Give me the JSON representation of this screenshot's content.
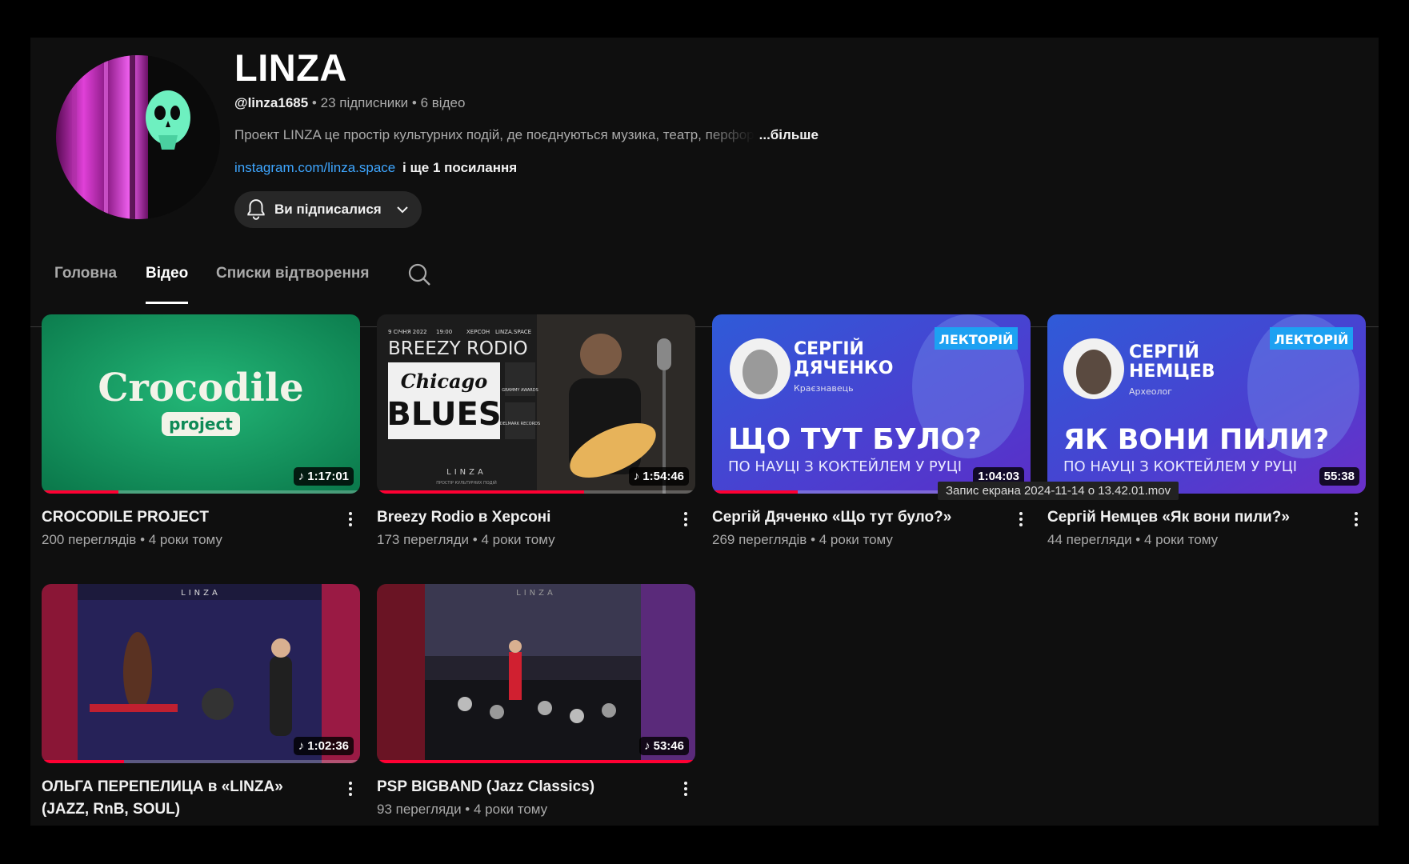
{
  "channel": {
    "name": "LINZA",
    "handle": "@linza1685",
    "subscribers": "23 підписники",
    "videos_count": "6 відео",
    "description": "Проект LINZA це простір культурних подій, де поєднуються музика, театр, перфор",
    "more_label": "...більше",
    "link_text": "instagram.com/linza.space",
    "more_links": "і ще 1 посилання",
    "subscribe_label": "Ви підписалися"
  },
  "tabs": [
    {
      "label": "Головна",
      "active": false
    },
    {
      "label": "Відео",
      "active": true
    },
    {
      "label": "Списки відтворення",
      "active": false
    }
  ],
  "videos": [
    {
      "title": "CROCODILE PROJECT",
      "views": "200 переглядів",
      "age": "4 роки тому",
      "duration": "1:17:01",
      "progress": 0.24,
      "thumb_text": [
        "Crocodile",
        "project"
      ]
    },
    {
      "title": "Breezy Rodio в Херсоні",
      "views": "173 перегляди",
      "age": "4 роки тому",
      "duration": "1:54:46",
      "progress": 0.65,
      "thumb_text": [
        "9 СІЧНЯ 2022",
        "19:00",
        "ХЕРСОН",
        "LINZA.SPACE",
        "BREEZY RODIO",
        "Chicago",
        "BLUES",
        "GRAMMY AWARDS",
        "DELMARK RECORDS",
        "LINZA",
        "ПРОСТІР КУЛЬТУРНИХ ПОДІЙ"
      ]
    },
    {
      "title": "Сергій Дяченко «Що тут було?»",
      "views": "269 переглядів",
      "age": "4 роки тому",
      "duration": "1:04:03",
      "progress": 0.27,
      "thumb_text": [
        "ЛЕКТОРІЙ",
        "СЕРГІЙ",
        "ДЯЧЕНКО",
        "Краєзнавець",
        "ЩО ТУТ БУЛО?",
        "ПО НАУЦІ З КОКТЕЙЛЕМ У РУЦІ"
      ]
    },
    {
      "title": "Сергій Немцев «Як вони пили?»",
      "views": "44 перегляди",
      "age": "4 роки тому",
      "duration": "55:38",
      "progress": 0,
      "thumb_text": [
        "ЛЕКТОРІЙ",
        "СЕРГІЙ",
        "НЕМЦЕВ",
        "Археолог",
        "ЯК ВОНИ ПИЛИ?",
        "ПО НАУЦІ З КОКТЕЙЛЕМ У РУЦІ"
      ]
    },
    {
      "title": "ОЛЬГА ПЕРЕПЕЛИЦА в «LINZA» (JAZZ, RnB, SOUL)",
      "views": "",
      "age": "",
      "duration": "1:02:36",
      "progress": 0.26,
      "thumb_text": [
        "LINZA"
      ]
    },
    {
      "title": "PSP BIGBAND (Jazz Classics)",
      "views": "93 перегляди",
      "age": "4 роки тому",
      "duration": "53:46",
      "progress": 1.0,
      "thumb_text": [
        "LINZA"
      ]
    }
  ],
  "tooltip": "Запис екрана 2024-11-14 о 13.42.01.mov",
  "icons": {
    "bell": "bell-icon",
    "chevron": "chevron-down-icon",
    "search": "search-icon",
    "music": "music-note-icon",
    "more": "more-vert-icon"
  },
  "colors": {
    "accent_link": "#3ea6ff",
    "progress": "#ff0033",
    "background": "#0f0f0f"
  }
}
